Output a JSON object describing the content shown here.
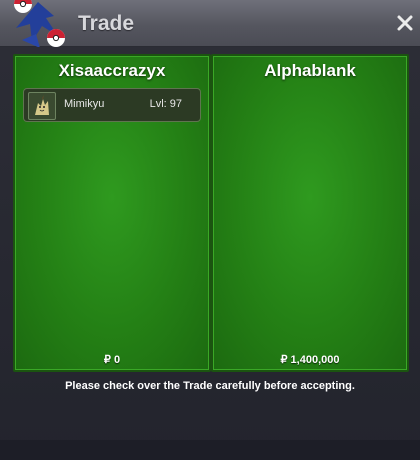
{
  "window": {
    "title": "Trade",
    "close_icon": "close-icon",
    "logo_icon": "pokeball-logo-icon"
  },
  "trade": {
    "left": {
      "player_name": "Xisaaccrazyx",
      "pokemon": [
        {
          "name": "Mimikyu",
          "level": "Lvl: 97",
          "icon": "mimikyu-sprite-icon"
        }
      ],
      "money": "₽ 0"
    },
    "right": {
      "player_name": "Alphablank",
      "pokemon": [],
      "money": "₽ 1,400,000"
    },
    "notice": "Please check over the Trade carefully before accepting."
  },
  "colors": {
    "panel_green": "#248015",
    "titlebar": "#5b5c66",
    "background": "#25262f",
    "logo_blue": "#233f9a",
    "logo_red": "#cc2233"
  }
}
